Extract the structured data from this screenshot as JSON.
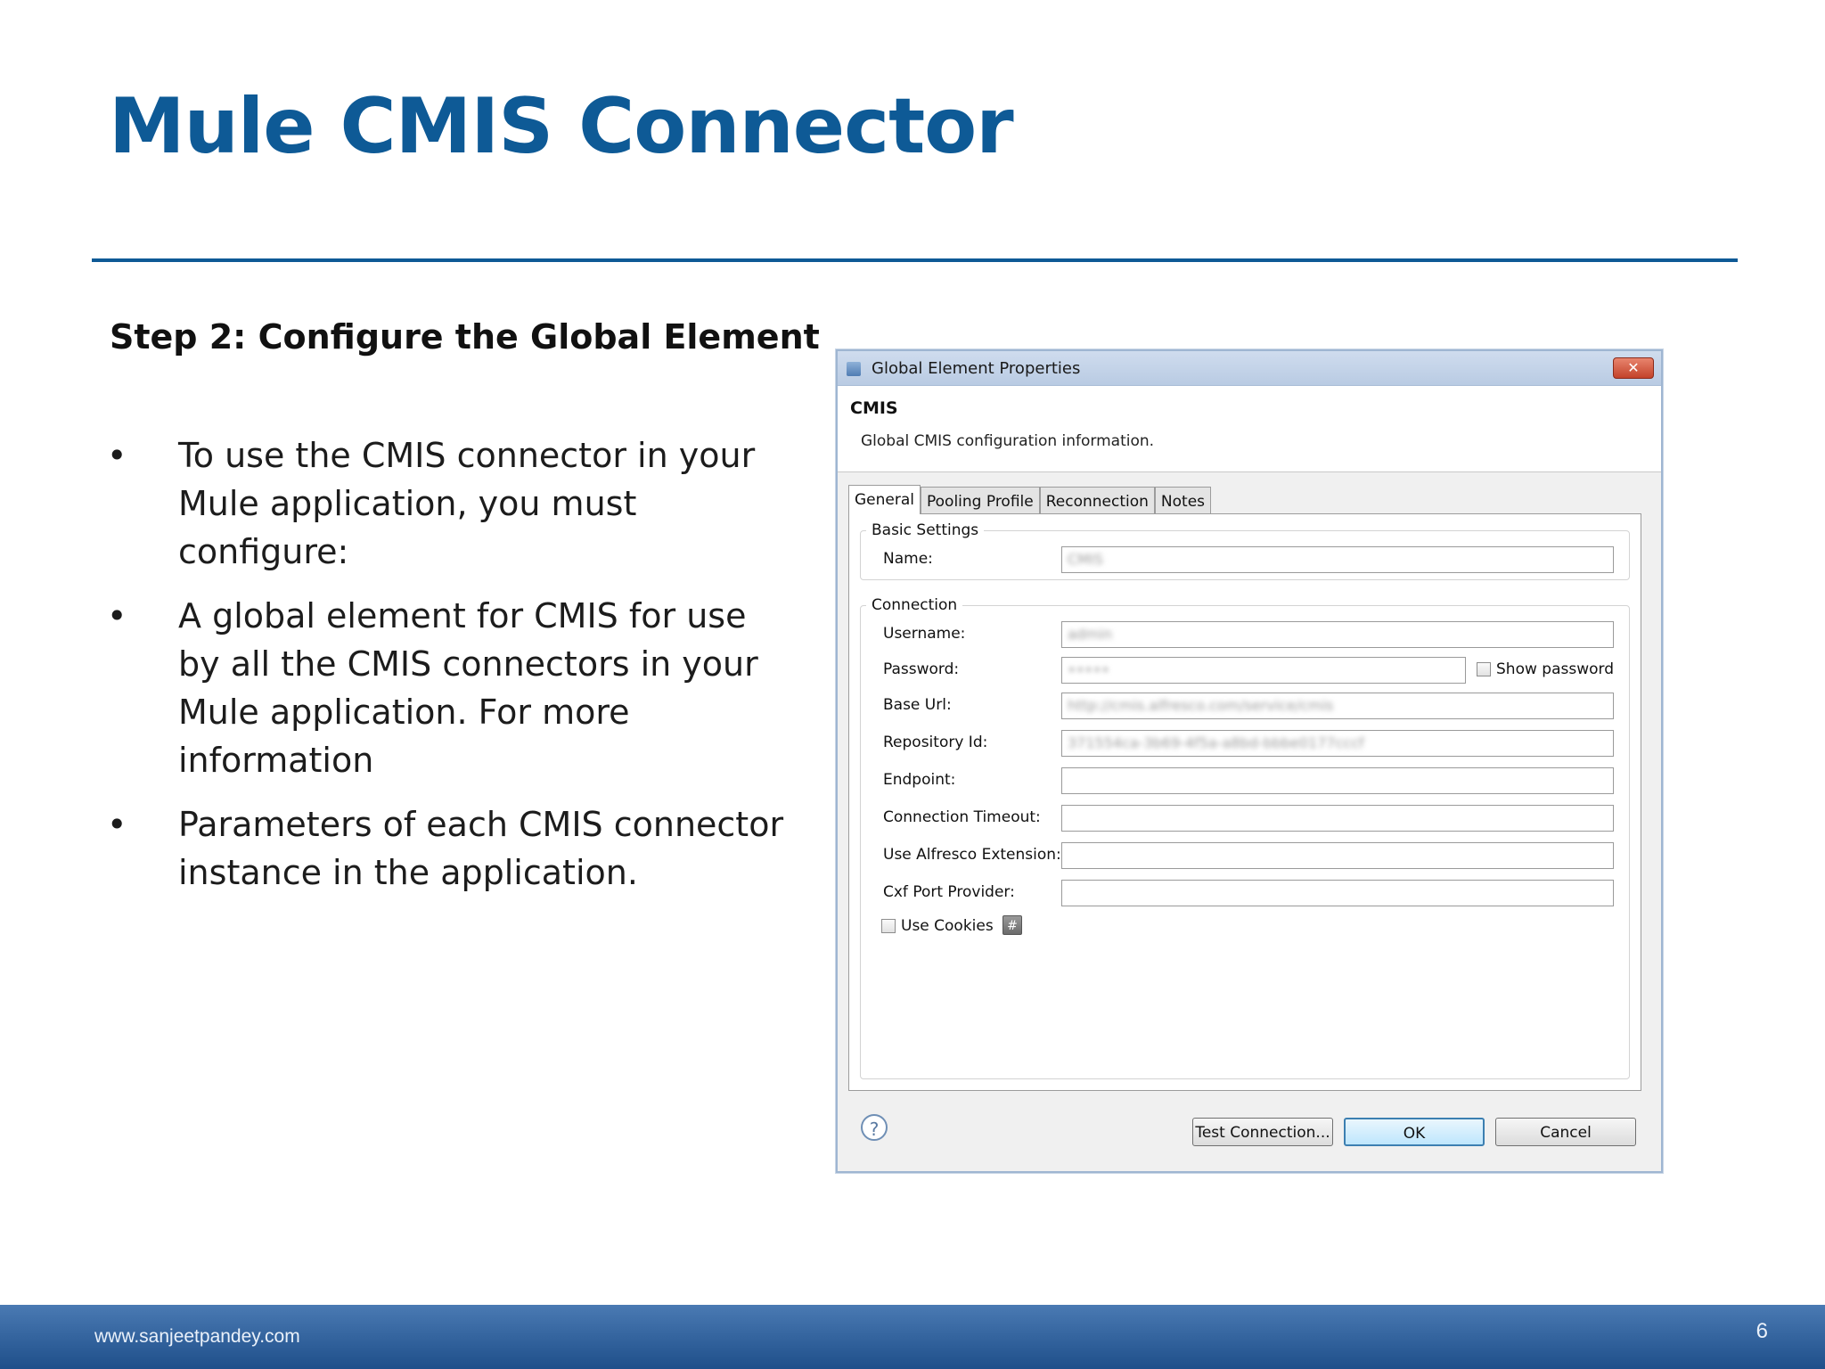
{
  "slide": {
    "title": "Mule CMIS Connector",
    "step_heading": "Step 2: Configure the Global Element",
    "bullets": [
      "To use the CMIS connector in your Mule application, you must configure:",
      "A global element for CMIS for use by all the CMIS connectors in your Mule application. For more information",
      "Parameters of each CMIS connector instance in the application."
    ],
    "bullet_glyph": "•"
  },
  "dialog": {
    "window_title": "Global Element Properties",
    "close_glyph": "✕",
    "header_title": "CMIS",
    "header_description": "Global CMIS configuration information.",
    "tabs": [
      "General",
      "Pooling Profile",
      "Reconnection",
      "Notes"
    ],
    "active_tab": "General",
    "basic_settings": {
      "legend": "Basic Settings",
      "name_label": "Name:",
      "name_value": "CMIS"
    },
    "connection": {
      "legend": "Connection",
      "username_label": "Username:",
      "username_value": "admin",
      "password_label": "Password:",
      "password_value": "•••••",
      "show_password_label": "Show password",
      "base_url_label": "Base Url:",
      "base_url_value": "http://cmis.alfresco.com/service/cmis",
      "repository_id_label": "Repository Id:",
      "repository_id_value": "371554ca-3b69-4f5a-a8bd-bbbe0177cccf",
      "endpoint_label": "Endpoint:",
      "connection_timeout_label": "Connection Timeout:",
      "use_alfresco_extension_label": "Use Alfresco Extension:",
      "cxf_port_provider_label": "Cxf Port Provider:",
      "use_cookies_label": "Use Cookies",
      "expression_btn_glyph": "#"
    },
    "help_glyph": "?",
    "buttons": {
      "test_connection": "Test Connection...",
      "ok": "OK",
      "cancel": "Cancel"
    }
  },
  "footer": {
    "website": "www.sanjeetpandey.com",
    "page_number": "6"
  },
  "colors": {
    "title_blue": "#0e5a96",
    "footer_blue": "#2a5a96"
  }
}
